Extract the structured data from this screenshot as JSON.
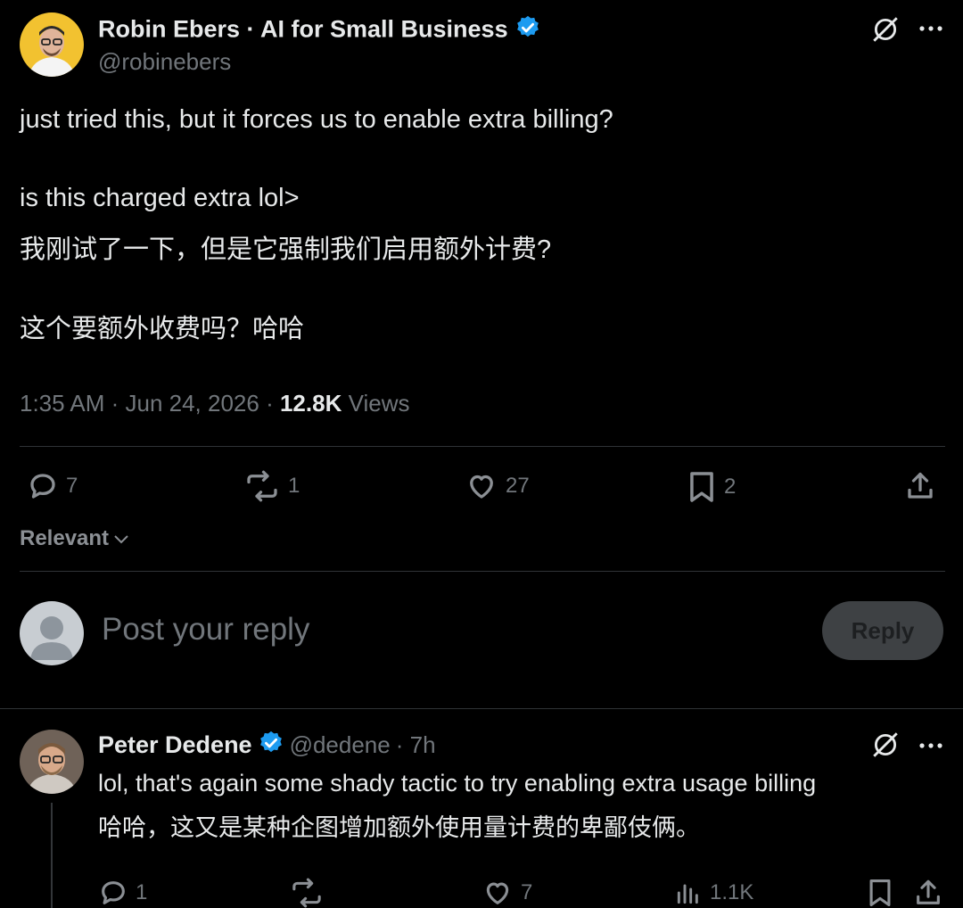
{
  "post": {
    "author_name": "Robin Ebers · AI for Small Business",
    "author_handle": "@robinebers",
    "text_line1": "just tried this, but it forces us to enable extra billing?",
    "text_line2": "is this charged extra lol>",
    "text_line3": "我刚试了一下，但是它强制我们启用额外计费?",
    "text_line4": "这个要额外收费吗？哈哈",
    "timestamp": "1:35 AM · Jun 24, 2026 · ",
    "views_count": "12.8K",
    "views_label": " Views",
    "stats": {
      "replies": "7",
      "reposts": "1",
      "likes": "27",
      "bookmarks": "2"
    }
  },
  "sort": {
    "label": "Relevant"
  },
  "composer": {
    "placeholder": "Post your reply",
    "button_label": "Reply"
  },
  "reply": {
    "author_name": "Peter Dedene",
    "author_handle": "@dedene",
    "time": " · 7h",
    "text_line1": "lol, that's again some shady tactic to try enabling extra usage billing",
    "text_line2": "哈哈，这又是某种企图增加额外使用量计费的卑鄙伎俩。",
    "stats": {
      "replies": "1",
      "likes": "7",
      "views": "1.1K"
    }
  },
  "colors": {
    "background": "#000000",
    "text": "#e7e9ea",
    "muted": "#71767b",
    "verified": "#1d9bf0",
    "divider": "#2f3336"
  }
}
